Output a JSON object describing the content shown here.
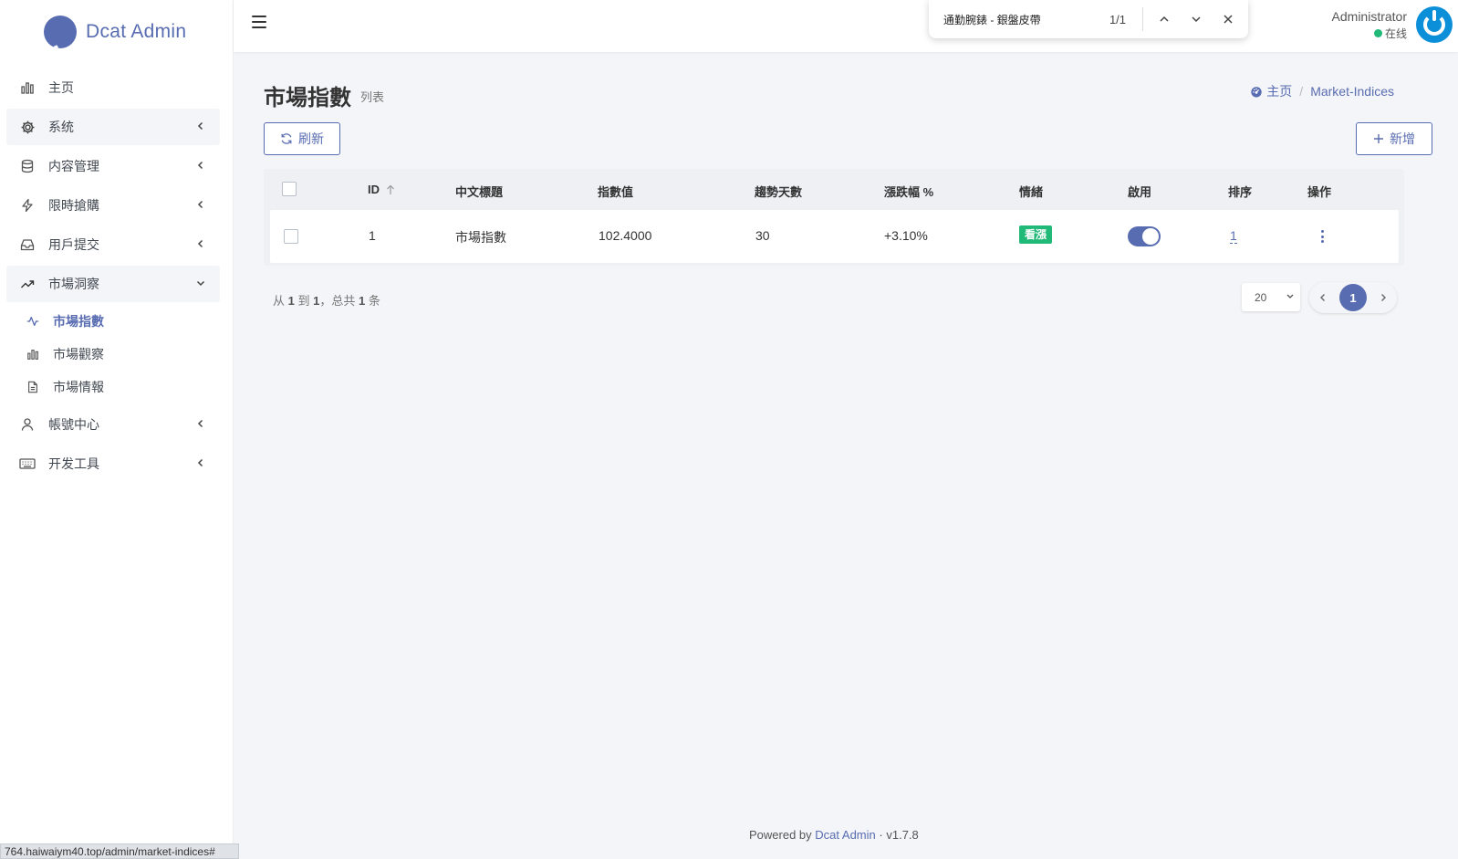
{
  "brand": {
    "name": "Dcat Admin"
  },
  "sidebar": {
    "items": [
      {
        "label": "主页",
        "icon": "bar-chart-icon"
      },
      {
        "label": "系统",
        "icon": "gear-icon"
      },
      {
        "label": "内容管理",
        "icon": "database-icon"
      },
      {
        "label": "限時搶購",
        "icon": "lightning-icon"
      },
      {
        "label": "用戶提交",
        "icon": "inbox-icon"
      },
      {
        "label": "市場洞察",
        "icon": "trending-up-icon"
      },
      {
        "label": "帳號中心",
        "icon": "user-icon"
      },
      {
        "label": "开发工具",
        "icon": "keyboard-icon"
      }
    ],
    "submenu": [
      {
        "label": "市場指數",
        "icon": "activity-icon"
      },
      {
        "label": "市場觀察",
        "icon": "bar-chart-icon"
      },
      {
        "label": "市場情報",
        "icon": "document-icon"
      }
    ]
  },
  "findbar": {
    "query": "通勤腕錶 - 銀盤皮帶",
    "count": "1/1"
  },
  "user": {
    "name": "Administrator",
    "status": "在线",
    "status_color": "#21b978"
  },
  "page": {
    "title": "市場指數",
    "subtitle": "列表"
  },
  "breadcrumb": {
    "home": "主页",
    "current": "Market-Indices"
  },
  "toolbar": {
    "refresh_label": "刷新",
    "add_label": "新增"
  },
  "table": {
    "columns": [
      "ID",
      "中文標題",
      "指數值",
      "趨勢天數",
      "漲跌幅 %",
      "情緒",
      "啟用",
      "排序",
      "操作"
    ],
    "rows": [
      {
        "id": "1",
        "title": "市場指數",
        "value": "102.4000",
        "days": "30",
        "change": "+3.10%",
        "sentiment": "看漲",
        "enabled": true,
        "order": "1"
      }
    ]
  },
  "summary": {
    "prefix": "从",
    "from": "1",
    "to_word": "到",
    "to": "1",
    "total_word": "，总共",
    "total": "1",
    "unit": "条"
  },
  "pagination": {
    "per_page": "20",
    "current": "1"
  },
  "footer": {
    "powered": "Powered by",
    "link": "Dcat Admin",
    "sep": "·",
    "version": "v1.7.8"
  },
  "status_url": "764.haiwaiym40.top/admin/market-indices#",
  "colors": {
    "primary": "#586cb1",
    "success": "#21b978",
    "avatar": "#0b8fd8"
  }
}
